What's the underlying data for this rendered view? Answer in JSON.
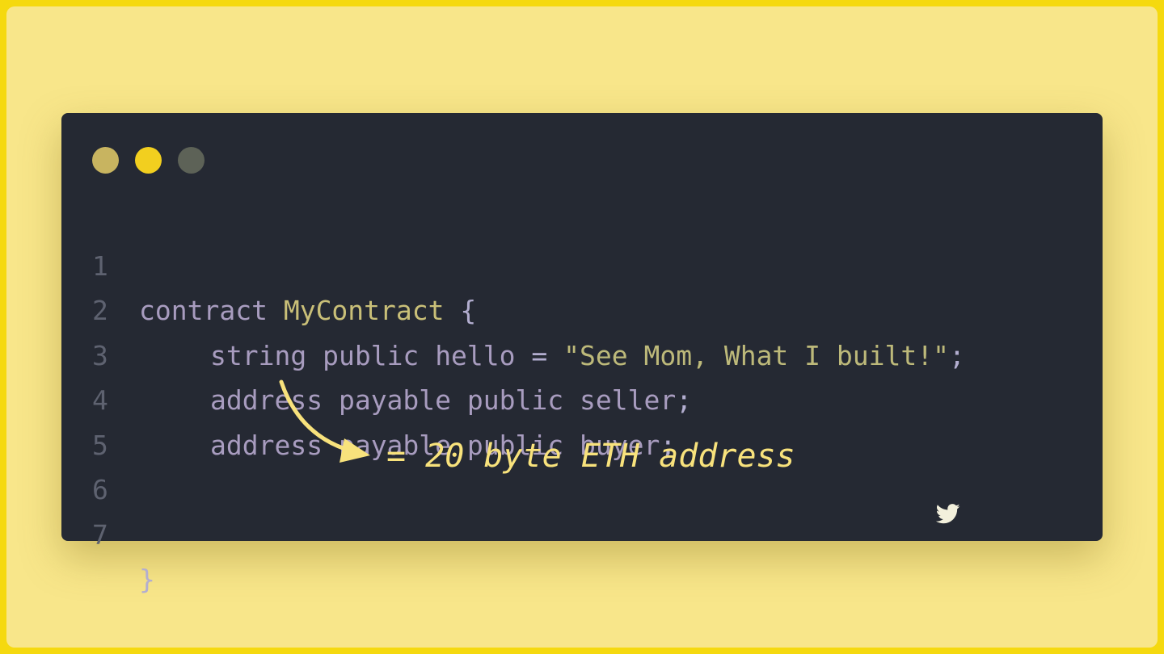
{
  "colors": {
    "outer_border": "#f5d90f",
    "background": "#f8e68a",
    "window_bg": "#252933",
    "dot_1": "#c8b460",
    "dot_2": "#f2cf1f",
    "dot_3": "#5d6257",
    "annotation": "#f8e27c"
  },
  "window": {
    "dots": [
      "window-dot-1",
      "window-dot-2",
      "window-dot-3"
    ]
  },
  "code": {
    "lines": [
      {
        "number": "1",
        "tokens": [
          "contract",
          " ",
          "MyContract",
          " ",
          "{"
        ]
      },
      {
        "number": "2",
        "tokens": [
          "string",
          " ",
          "public",
          " ",
          "hello",
          " ",
          "=",
          " ",
          "\"See Mom, What I built!\"",
          ";"
        ]
      },
      {
        "number": "3",
        "tokens": [
          "address",
          " ",
          "payable",
          " ",
          "public",
          " ",
          "seller",
          ";"
        ]
      },
      {
        "number": "4",
        "tokens": [
          "address",
          " ",
          "payable",
          " ",
          "public",
          " ",
          "buyer",
          ";"
        ]
      },
      {
        "number": "5",
        "tokens": []
      },
      {
        "number": "6",
        "tokens": []
      },
      {
        "number": "7",
        "tokens": [
          "}"
        ]
      }
    ]
  },
  "annotation": {
    "text": "= 20 byte ETH address"
  },
  "icons": {
    "arrow": "curved-arrow-icon",
    "brand": "twitter-bird-icon"
  }
}
